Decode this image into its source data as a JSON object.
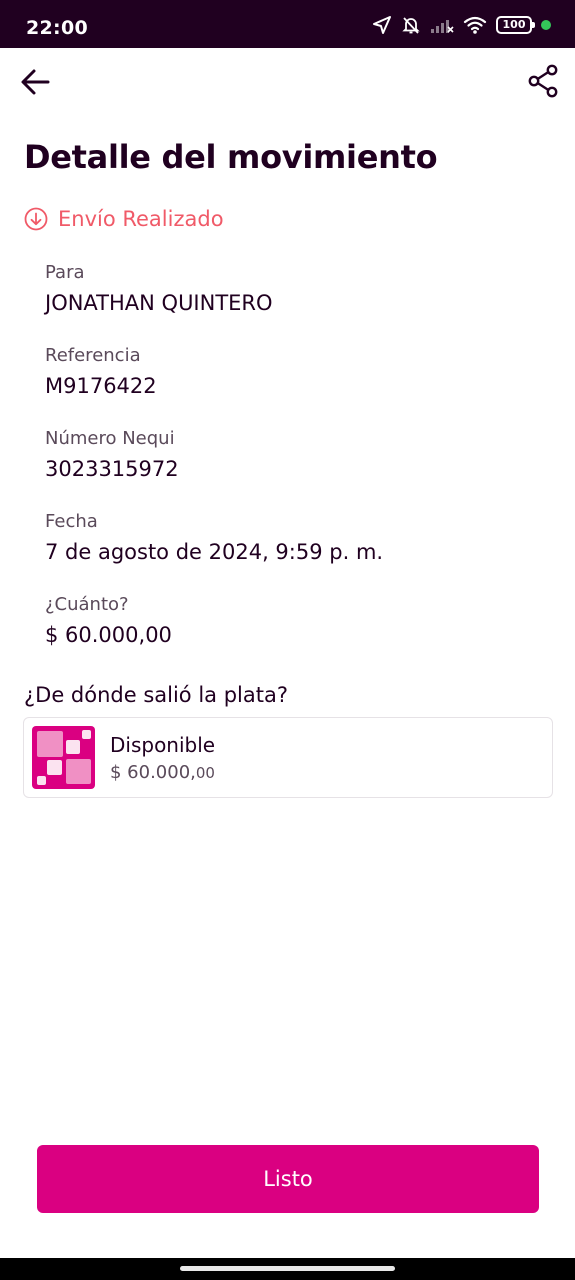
{
  "status_bar": {
    "time": "22:00",
    "battery": "100",
    "icons": [
      "location-arrow-icon",
      "bell-muted-icon",
      "signal-off-icon",
      "wifi-icon",
      "battery-icon",
      "active-dot"
    ]
  },
  "app_bar": {
    "back_icon": "arrow-left-icon",
    "share_icon": "share-icon"
  },
  "title": "Detalle del movimiento",
  "movement_status": {
    "icon": "circle-arrow-down-icon",
    "label": "Envío Realizado",
    "color": "#f05a68"
  },
  "details": [
    {
      "label": "Para",
      "value": "JONATHAN QUINTERO"
    },
    {
      "label": "Referencia",
      "value": "M9176422"
    },
    {
      "label": "Número Nequi",
      "value": "3023315972"
    },
    {
      "label": "Fecha",
      "value": "7 de agosto de 2024, 9:59 p. m."
    },
    {
      "label": "¿Cuánto?",
      "value": "$ 60.000,00"
    }
  ],
  "source": {
    "heading": "¿De dónde salió la plata?",
    "name": "Disponible",
    "amount_main": "$ 60.000,",
    "amount_cents": "00"
  },
  "done_button": "Listo",
  "colors": {
    "brand": "#da0081",
    "dark": "#200020",
    "status_red": "#f05a68"
  }
}
